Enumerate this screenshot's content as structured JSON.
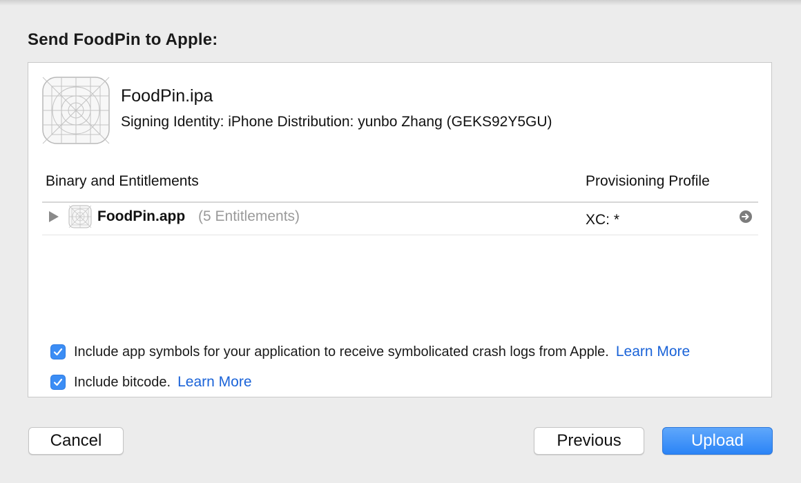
{
  "dialog": {
    "title": "Send FoodPin to Apple:"
  },
  "package": {
    "file_name": "FoodPin.ipa",
    "signing_identity": "Signing Identity: iPhone Distribution: yunbo Zhang (GEKS92Y5GU)",
    "icon": "app-placeholder-icon"
  },
  "table": {
    "columns": [
      "Binary and Entitlements",
      "Provisioning Profile"
    ],
    "rows": [
      {
        "app_name": "FoodPin.app",
        "entitlements": "(5 Entitlements)",
        "profile": "XC: *",
        "icon": "app-placeholder-icon"
      }
    ]
  },
  "options": {
    "symbols": {
      "checked": true,
      "label": "Include app symbols for your application to receive symbolicated crash logs from Apple.",
      "link": "Learn More"
    },
    "bitcode": {
      "checked": true,
      "label": "Include bitcode.",
      "link": "Learn More"
    }
  },
  "buttons": {
    "cancel": "Cancel",
    "previous": "Previous",
    "upload": "Upload"
  },
  "colors": {
    "accent": "#2b84f6",
    "link": "#1a63d8",
    "background": "#ececec"
  }
}
